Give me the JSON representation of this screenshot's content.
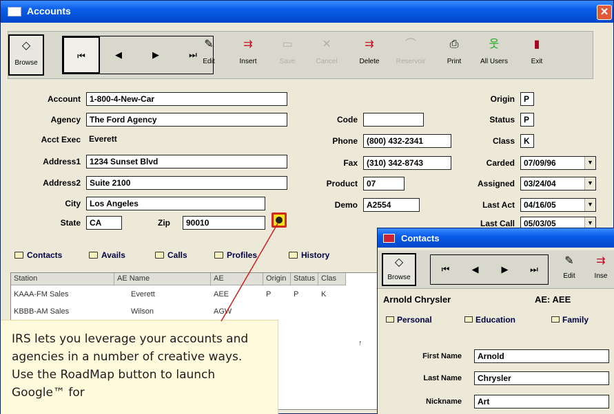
{
  "window": {
    "title": "Accounts",
    "close_label": "✕"
  },
  "toolbar": {
    "browse": "Browse",
    "edit": "Edit",
    "insert": "Insert",
    "save": "Save",
    "cancel": "Cancel",
    "delete": "Delete",
    "reservoir": "Reservoir",
    "print": "Print",
    "all_users": "All Users",
    "exit": "Exit",
    "first": "⏮",
    "prev": "◀",
    "next": "▶",
    "last": "⏭"
  },
  "form": {
    "account": {
      "label": "Account",
      "value": "1-800-4-New-Car"
    },
    "agency": {
      "label": "Agency",
      "value": "The Ford Agency"
    },
    "acct_exec": {
      "label": "Acct Exec",
      "value": "Everett"
    },
    "address1": {
      "label": "Address1",
      "value": "1234 Sunset Blvd"
    },
    "address2": {
      "label": "Address2",
      "value": "Suite 2100"
    },
    "city": {
      "label": "City",
      "value": "Los Angeles"
    },
    "state": {
      "label": "State",
      "value": "CA"
    },
    "zip": {
      "label": "Zip",
      "value": "90010"
    },
    "code": {
      "label": "Code",
      "value": ""
    },
    "phone": {
      "label": "Phone",
      "value": "(800) 432-2341"
    },
    "fax": {
      "label": "Fax",
      "value": "(310) 342-8743"
    },
    "product": {
      "label": "Product",
      "value": "07"
    },
    "demo": {
      "label": "Demo",
      "value": "A2554"
    },
    "origin": {
      "label": "Origin",
      "value": "P"
    },
    "status": {
      "label": "Status",
      "value": "P"
    },
    "class": {
      "label": "Class",
      "value": "K"
    },
    "carded": {
      "label": "Carded",
      "value": "07/09/96"
    },
    "assigned": {
      "label": "Assigned",
      "value": "03/24/04"
    },
    "last_act": {
      "label": "Last Act",
      "value": "04/16/05"
    },
    "last_call": {
      "label": "Last Call",
      "value": "05/03/05"
    }
  },
  "tabs": [
    "Contacts",
    "Avails",
    "Calls",
    "Profiles",
    "History"
  ],
  "grid": {
    "headers": [
      "Station",
      "AE Name",
      "AE",
      "Origin",
      "Status",
      "Clas"
    ],
    "rows": [
      [
        "KAAA-FM Sales",
        "Everett",
        "AEE",
        "P",
        "P",
        "K"
      ],
      [
        "KBBB-AM Sales",
        "Wilson",
        "AGW",
        "",
        "",
        ""
      ]
    ],
    "extra_mark": "↑"
  },
  "callout": {
    "text": "IRS lets you leverage your accounts and agencies in a number of creative ways. Use the RoadMap button to launch Google™ for"
  },
  "contacts": {
    "title": "Contacts",
    "browse": "Browse",
    "edit": "Edit",
    "insert": "Inse",
    "name": "Arnold Chrysler",
    "ae": "AE: AEE",
    "tabs": [
      "Personal",
      "Education",
      "Family"
    ],
    "first_name": {
      "label": "First Name",
      "value": "Arnold"
    },
    "last_name": {
      "label": "Last Name",
      "value": "Chrysler"
    },
    "nickname": {
      "label": "Nickname",
      "value": "Art"
    }
  }
}
